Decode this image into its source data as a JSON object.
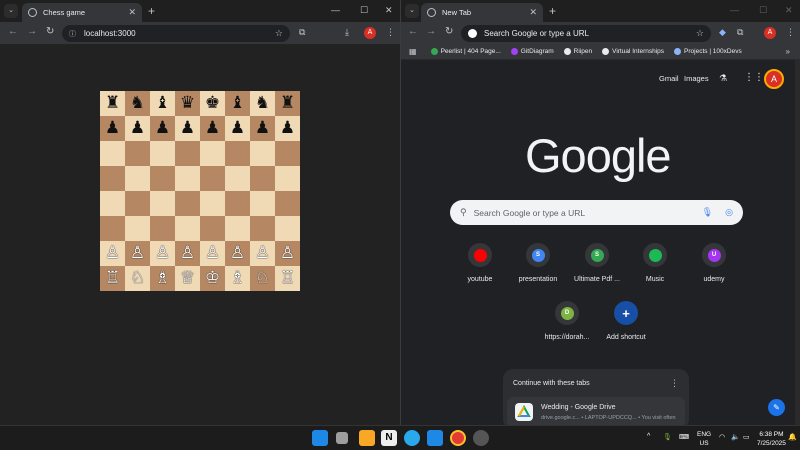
{
  "left_window": {
    "tab_title": "Chess game",
    "url": "localhost:3000",
    "board": [
      [
        "♜",
        "♞",
        "♝",
        "♛",
        "♚",
        "♝",
        "♞",
        "♜"
      ],
      [
        "♟",
        "♟",
        "♟",
        "♟",
        "♟",
        "♟",
        "♟",
        "♟"
      ],
      [
        "",
        "",
        "",
        "",
        "",
        "",
        "",
        ""
      ],
      [
        "",
        "",
        "",
        "",
        "",
        "",
        "",
        ""
      ],
      [
        "",
        "",
        "",
        "",
        "",
        "",
        "",
        ""
      ],
      [
        "",
        "",
        "",
        "",
        "",
        "",
        "",
        ""
      ],
      [
        "♙",
        "♙",
        "♙",
        "♙",
        "♙",
        "♙",
        "♙",
        "♙"
      ],
      [
        "♖",
        "♘",
        "♗",
        "♕",
        "♔",
        "♗",
        "♘",
        "♖"
      ]
    ],
    "avatar_letter": "A"
  },
  "right_window": {
    "tab_title": "New Tab",
    "omnibox_placeholder": "Search Google or type a URL",
    "avatar_letter": "A",
    "bookmarks": [
      {
        "label": "Peerlist | 404 Page...",
        "color": "#34a853"
      },
      {
        "label": "GitDiagram",
        "color": "#a142f4"
      },
      {
        "label": "Riipen",
        "color": "#e8eaed"
      },
      {
        "label": "Virtual Internships",
        "color": "#e8eaed"
      },
      {
        "label": "Projects | 100xDevs",
        "color": "#8ab4f8"
      }
    ],
    "links": {
      "gmail": "Gmail",
      "images": "Images"
    },
    "logo": "Google",
    "search_placeholder": "Search Google or type a URL",
    "shortcuts": [
      {
        "label": "youtube",
        "letter": "",
        "color": "#ff0000"
      },
      {
        "label": "presentation",
        "letter": "S",
        "color": "#4285f4"
      },
      {
        "label": "Ultimate Pdf ...",
        "letter": "S",
        "color": "#34a853"
      },
      {
        "label": "Music",
        "letter": "",
        "color": "#1db954"
      },
      {
        "label": "udemy",
        "letter": "U",
        "color": "#a435f0"
      },
      {
        "label": "https://dorah...",
        "letter": "D",
        "color": "#7cb342"
      },
      {
        "label": "Add shortcut",
        "letter": "+",
        "color": "#174ea6"
      }
    ],
    "continue_card": {
      "title": "Continue with these tabs",
      "item_name": "Wedding - Google Drive",
      "item_sub": "drive.google.c... • LAPTOP-UPDCCQ... • You visit often"
    }
  },
  "taskbar": {
    "lang": "ENG",
    "region": "US",
    "time": "6:38 PM",
    "date": "7/25/2025"
  }
}
